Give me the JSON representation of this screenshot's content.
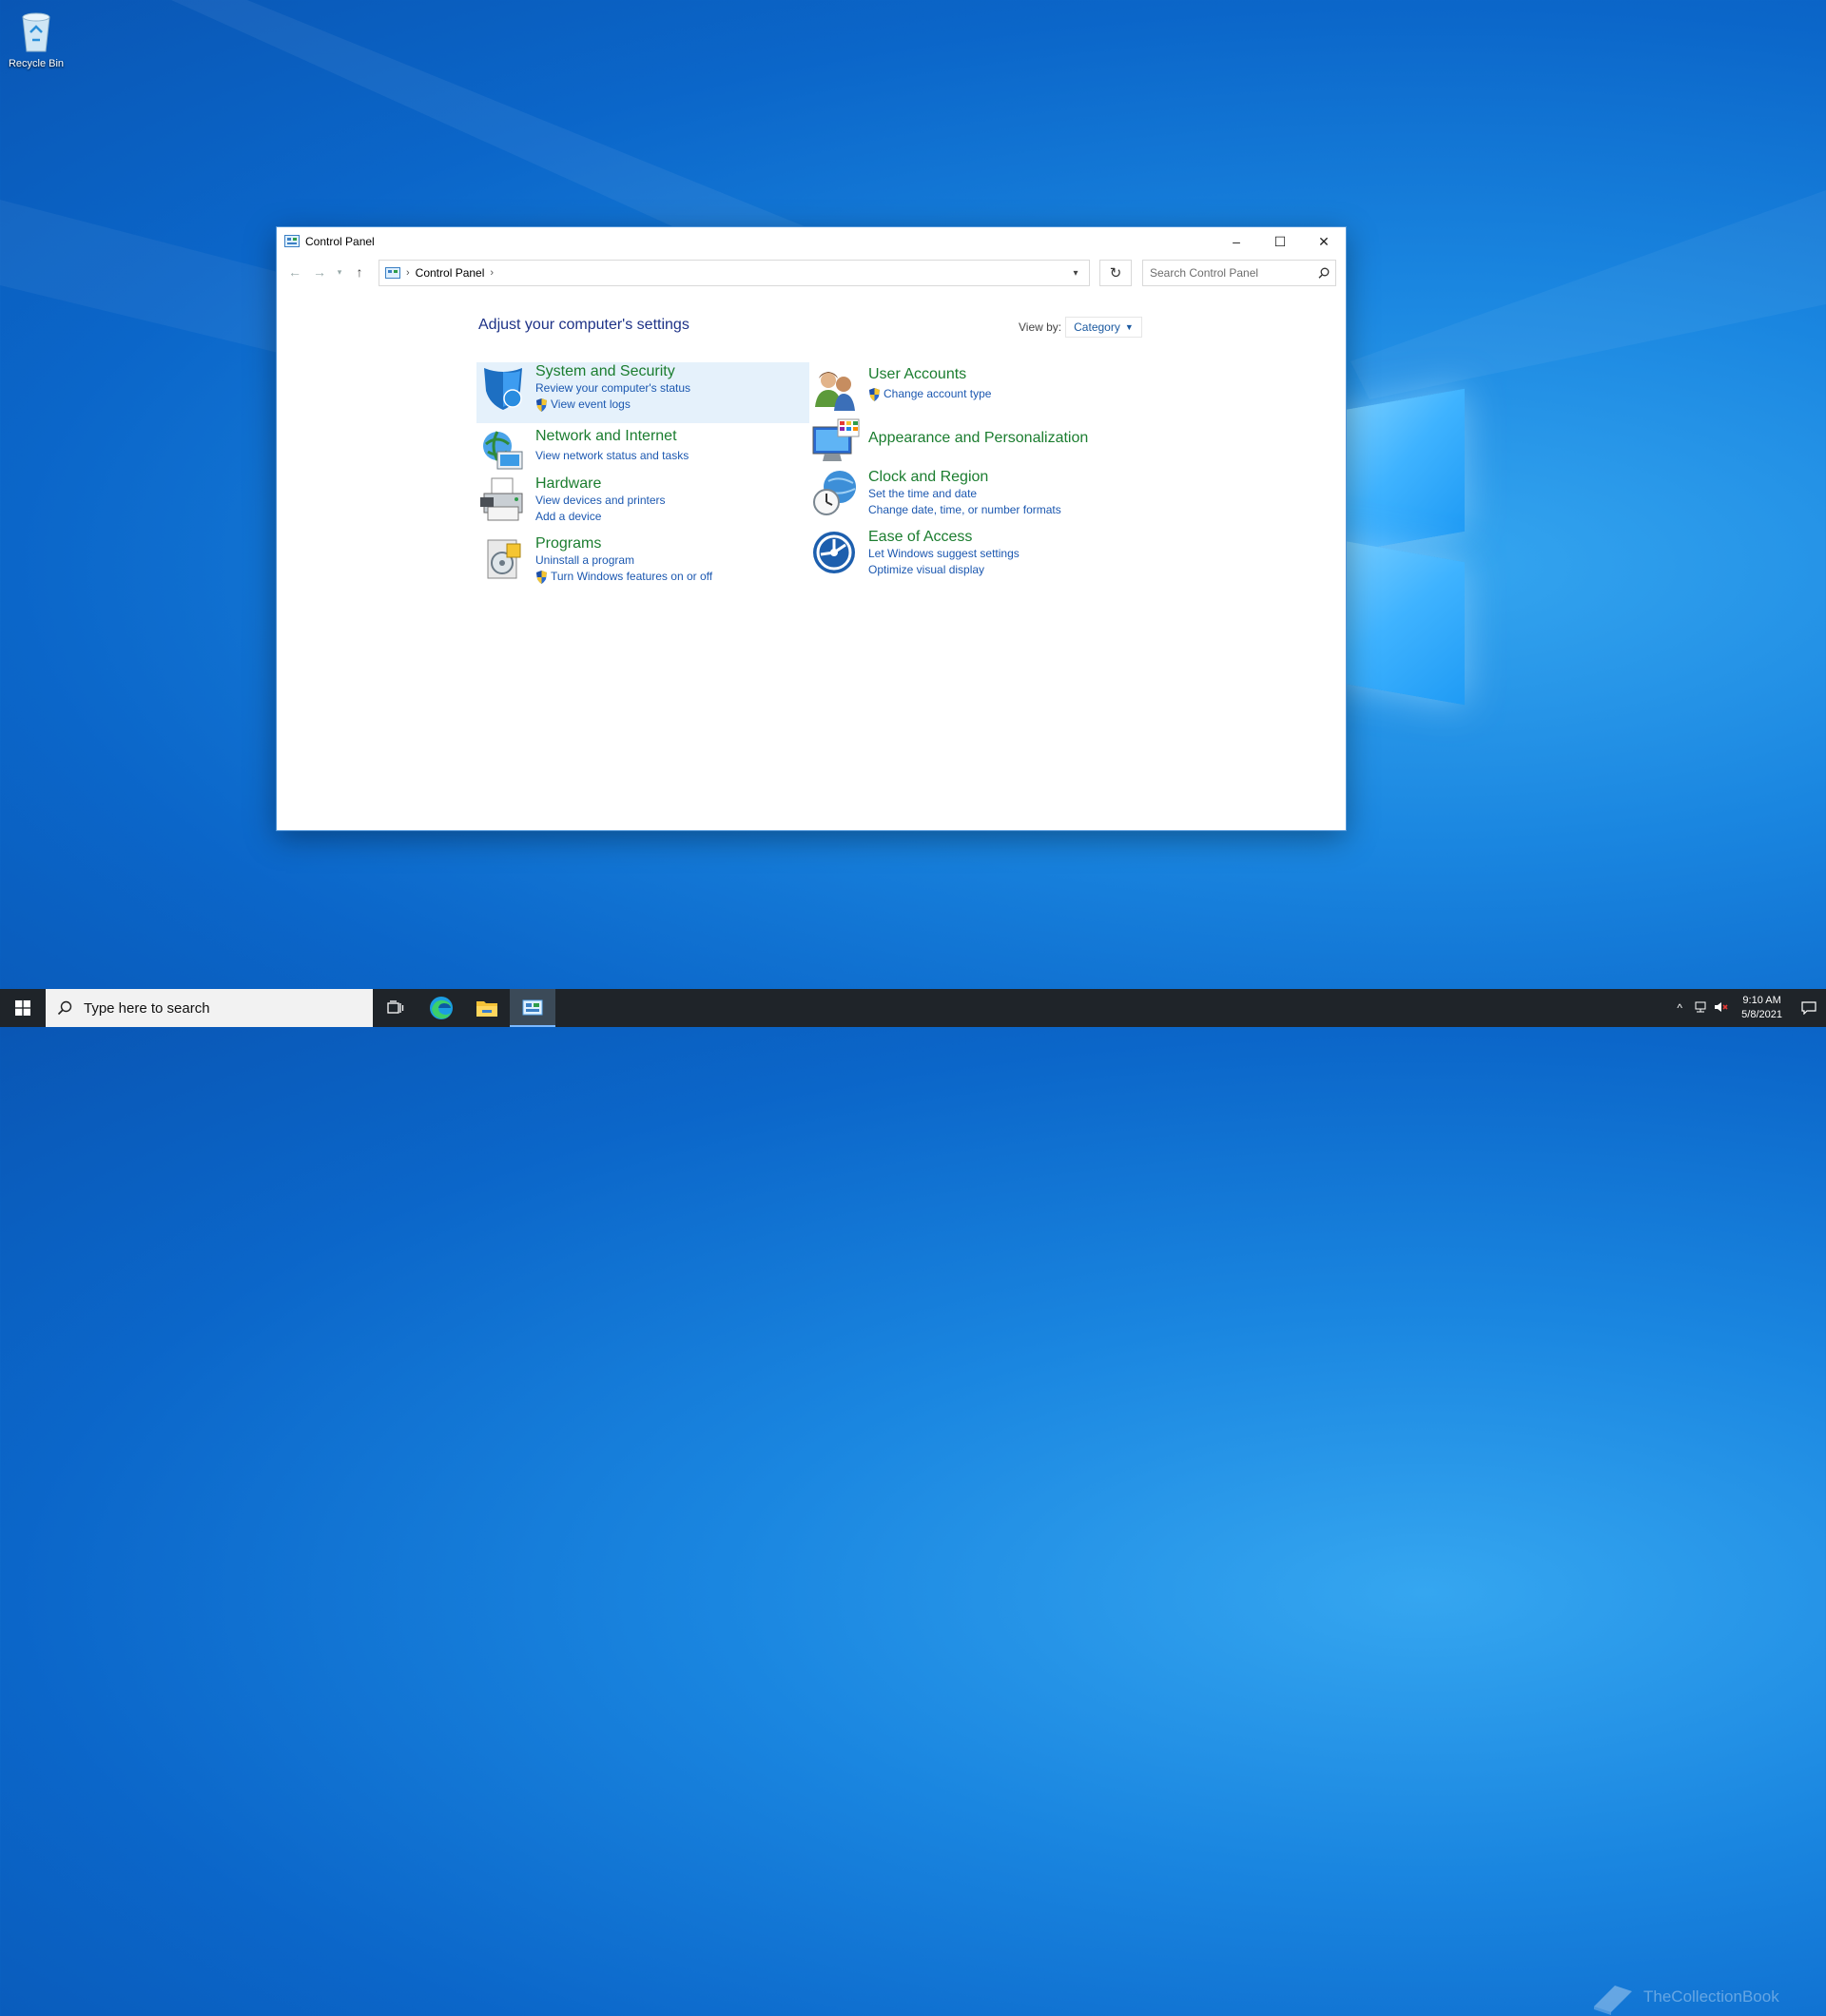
{
  "desktop": {
    "recycle_bin_label": "Recycle Bin"
  },
  "window": {
    "title": "Control Panel",
    "minimize_label": "–",
    "maximize_label": "☐",
    "close_label": "✕"
  },
  "navigation": {
    "breadcrumb": [
      "Control Panel"
    ],
    "search_placeholder": "Search Control Panel"
  },
  "content": {
    "heading": "Adjust your computer's settings",
    "view_by_label": "View by:",
    "view_by_value": "Category",
    "categories": [
      {
        "title": "System and Security",
        "icon": "shield-icon",
        "links": [
          "Review your computer's status",
          "View event logs"
        ],
        "shield_links": [
          false,
          true
        ]
      },
      {
        "title": "Network and Internet",
        "icon": "globe-network-icon",
        "links": [
          "View network status and tasks"
        ],
        "shield_links": [
          false
        ]
      },
      {
        "title": "Hardware",
        "icon": "printer-icon",
        "links": [
          "View devices and printers",
          "Add a device"
        ],
        "shield_links": [
          false,
          false
        ]
      },
      {
        "title": "Programs",
        "icon": "programs-icon",
        "links": [
          "Uninstall a program",
          "Turn Windows features on or off"
        ],
        "shield_links": [
          false,
          true
        ]
      },
      {
        "title": "User Accounts",
        "icon": "users-icon",
        "links": [
          "Change account type"
        ],
        "shield_links": [
          true
        ]
      },
      {
        "title": "Appearance and Personalization",
        "icon": "monitor-palette-icon",
        "links": [],
        "shield_links": []
      },
      {
        "title": "Clock and Region",
        "icon": "clock-globe-icon",
        "links": [
          "Set the time and date",
          "Change date, time, or number formats"
        ],
        "shield_links": [
          false,
          false
        ]
      },
      {
        "title": "Ease of Access",
        "icon": "ease-of-access-icon",
        "links": [
          "Let Windows suggest settings",
          "Optimize visual display"
        ],
        "shield_links": [
          false,
          false
        ]
      }
    ]
  },
  "taskbar": {
    "search_placeholder": "Type here to search",
    "time": "9:10 AM",
    "date": "5/8/2021",
    "watermark": "TheCollectionBook"
  },
  "colors": {
    "accent": "#0078d7",
    "link": "#1c58b0",
    "category_title": "#1b7d2f",
    "taskbar": "#1f2429"
  }
}
